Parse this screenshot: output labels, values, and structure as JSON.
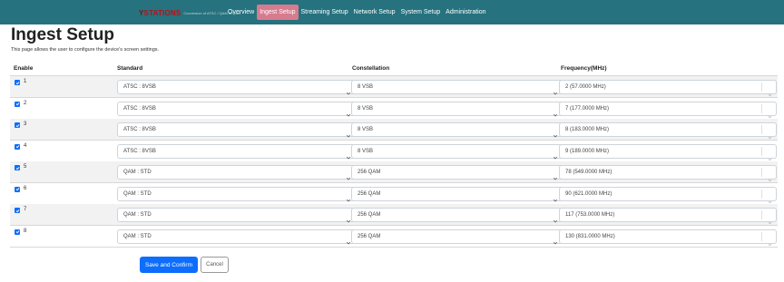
{
  "brand": {
    "logo_mark": "Y",
    "logo_text": "STATIONS",
    "tagline": "Conversion of ATSC / QAM to Ipnet"
  },
  "nav": {
    "items": [
      {
        "label": "Overview",
        "active": false
      },
      {
        "label": "Ingest Setup",
        "active": true
      },
      {
        "label": "Streaming Setup",
        "active": false
      },
      {
        "label": "Network Setup",
        "active": false
      },
      {
        "label": "System Setup",
        "active": false
      },
      {
        "label": "Administration",
        "active": false
      }
    ]
  },
  "page": {
    "title": "Ingest Setup",
    "description": "This page allows the user to configure the device's screen settings."
  },
  "table": {
    "headers": {
      "enable": "Enable",
      "standard": "Standard",
      "constellation": "Constellation",
      "frequency": "Frequency(MHz)"
    },
    "rows": [
      {
        "num": "1",
        "enabled": true,
        "standard": "ATSC : 8VSB",
        "constellation": "8 VSB",
        "frequency": "2 (57.0000 MHz)"
      },
      {
        "num": "2",
        "enabled": true,
        "standard": "ATSC : 8VSB",
        "constellation": "8 VSB",
        "frequency": "7 (177.0000 MHz)"
      },
      {
        "num": "3",
        "enabled": true,
        "standard": "ATSC : 8VSB",
        "constellation": "8 VSB",
        "frequency": "8 (183.0000 MHz)"
      },
      {
        "num": "4",
        "enabled": true,
        "standard": "ATSC : 8VSB",
        "constellation": "8 VSB",
        "frequency": "9 (189.0000 MHz)"
      },
      {
        "num": "5",
        "enabled": true,
        "standard": "QAM : STD",
        "constellation": "256 QAM",
        "frequency": "78 (549.0000 MHz)"
      },
      {
        "num": "6",
        "enabled": true,
        "standard": "QAM : STD",
        "constellation": "256 QAM",
        "frequency": "90 (621.0000 MHz)"
      },
      {
        "num": "7",
        "enabled": true,
        "standard": "QAM : STD",
        "constellation": "256 QAM",
        "frequency": "117 (753.0000 MHz)"
      },
      {
        "num": "8",
        "enabled": true,
        "standard": "QAM : STD",
        "constellation": "256 QAM",
        "frequency": "130 (831.0000 MHz)"
      }
    ]
  },
  "actions": {
    "save_label": "Save and Confirm",
    "cancel_label": "Cancel"
  },
  "icons": {
    "checkbox": "checkbox-checked-icon",
    "select_chevron": "chevron-down-icon"
  },
  "colors": {
    "navbar": "#26727e",
    "active_tab": "#d77b8f",
    "primary": "#0d6efd",
    "stripe": "#f2f2f2"
  }
}
